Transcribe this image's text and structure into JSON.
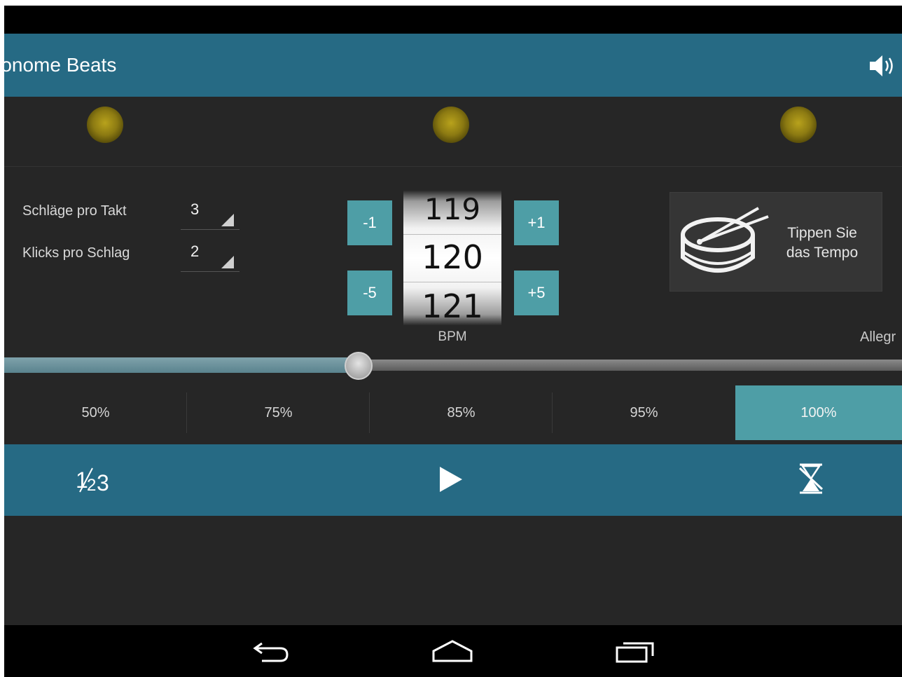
{
  "action_bar": {
    "title": "ronome Beats",
    "sound_icon": "speaker-icon"
  },
  "beats": {
    "count": 3,
    "light_color": "#b8a21c"
  },
  "settings": {
    "beats_per_measure_label": "Schläge pro Takt",
    "beats_per_measure_value": "3",
    "clicks_per_beat_label": "Klicks pro Schlag",
    "clicks_per_beat_value": "2"
  },
  "tempo": {
    "minus1": "-1",
    "minus5": "-5",
    "plus1": "+1",
    "plus5": "+5",
    "prev": "119",
    "current": "120",
    "next": "121",
    "unit": "BPM",
    "tempo_name": "Allegr",
    "slider_fraction": 0.395
  },
  "tap": {
    "line1": "Tippen Sie",
    "line2": "das Tempo",
    "icon": "drum-icon"
  },
  "percent_options": [
    {
      "label": "50%",
      "selected": false
    },
    {
      "label": "75%",
      "selected": false
    },
    {
      "label": "85%",
      "selected": false
    },
    {
      "label": "95%",
      "selected": false
    },
    {
      "label": "100%",
      "selected": true
    }
  ],
  "bottom_bar": {
    "left_icon": "subdivision-icon",
    "left_label": "1/23",
    "center_icon": "play-icon",
    "right_icon": "timer-off-icon"
  },
  "colors": {
    "accent_bar": "#266a84",
    "button": "#4e9ea6",
    "background": "#262626"
  },
  "nav": {
    "back_icon": "back-icon",
    "home_icon": "home-icon",
    "recents_icon": "recents-icon"
  }
}
